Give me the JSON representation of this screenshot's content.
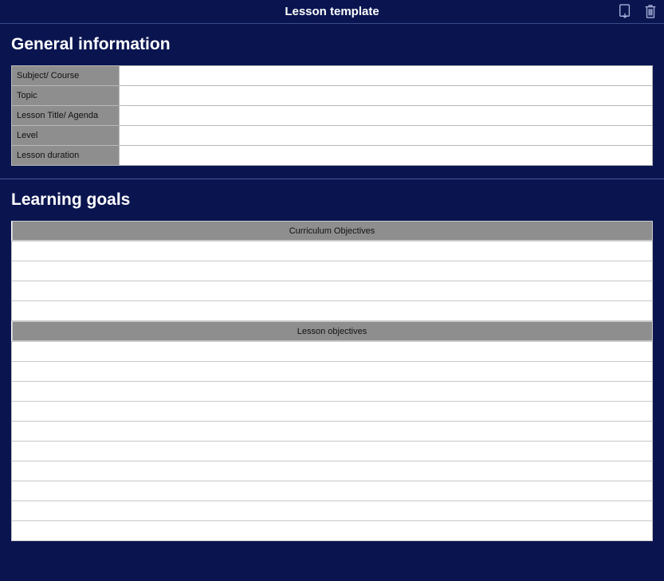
{
  "header": {
    "title": "Lesson template"
  },
  "section1": {
    "title": "General information",
    "rows": {
      "r0": {
        "label": "Subject/ Course",
        "value": ""
      },
      "r1": {
        "label": "Topic",
        "value": ""
      },
      "r2": {
        "label": "Lesson Title/ Agenda",
        "value": ""
      },
      "r3": {
        "label": "Level",
        "value": ""
      },
      "r4": {
        "label": "Lesson duration",
        "value": ""
      }
    }
  },
  "section2": {
    "title": "Learning goals",
    "group1": {
      "header": "Curriculum Objectives"
    },
    "group2": {
      "header": "Lesson objectives"
    }
  }
}
